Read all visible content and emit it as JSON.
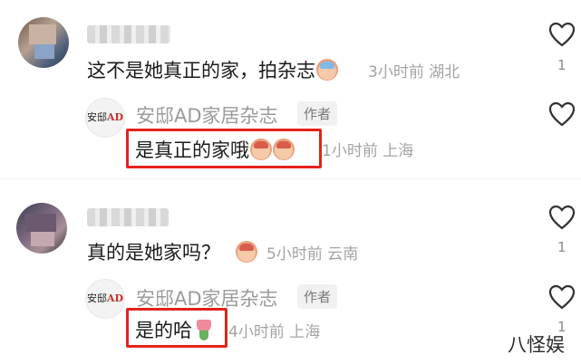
{
  "comments": [
    {
      "text": "这不是她真正的家，拍杂志",
      "emoji": "laughing-crying-face-emoji",
      "time": "3小时前",
      "location": "湖北",
      "likes": "1",
      "reply": {
        "author": "安邸AD家居杂志",
        "author_tag": "作者",
        "logo_text_a": "安邸",
        "logo_text_b": "AD",
        "text": "是真正的家哦",
        "emoji": "shy-face-emoji",
        "time": "1小时前",
        "location": "上海",
        "likes": ""
      }
    },
    {
      "text": "真的是她家吗？",
      "emoji": "shy-face-emoji",
      "time": "5小时前",
      "location": "云南",
      "likes": "1",
      "reply": {
        "author": "安邸AD家居杂志",
        "author_tag": "作者",
        "logo_text_a": "安邸",
        "logo_text_b": "AD",
        "text": "是的哈",
        "emoji": "tulip-emoji",
        "time": "4小时前",
        "location": "上海",
        "likes": "1"
      }
    }
  ],
  "watermark": "八怪娱",
  "colors": {
    "highlight": "#e2231a",
    "meta": "#a3a3a3",
    "author": "#9a9a9a"
  }
}
